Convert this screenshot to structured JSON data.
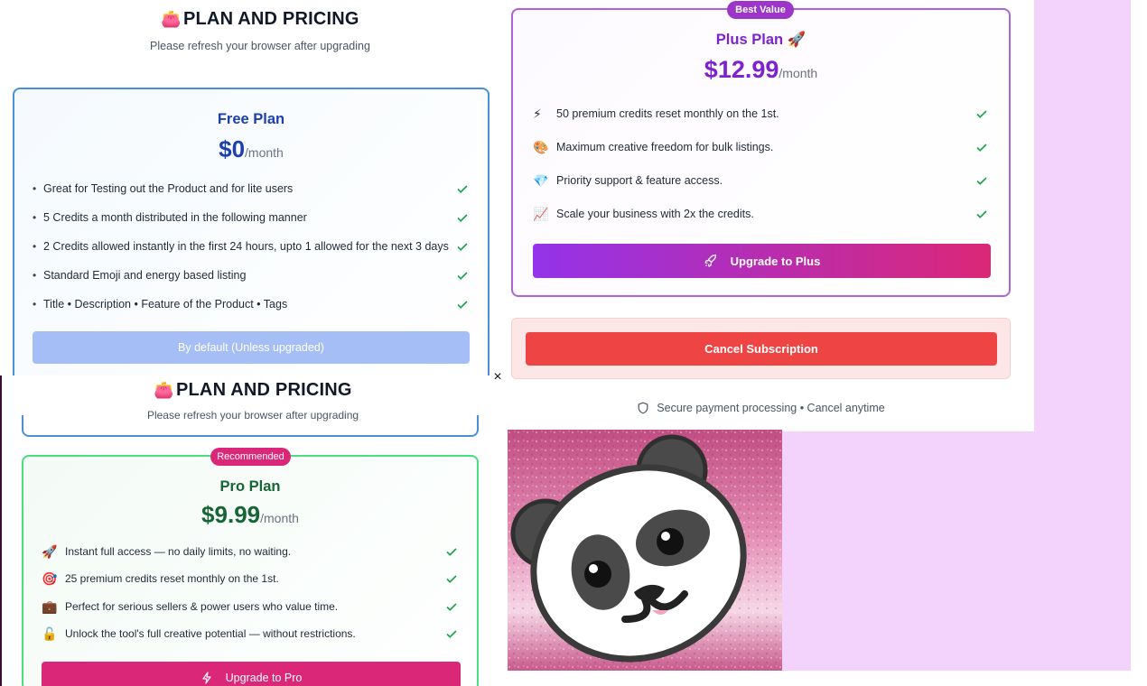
{
  "pricing_top": {
    "title": "PLAN AND PRICING",
    "subtitle": "Please refresh your browser after upgrading"
  },
  "free_plan": {
    "name": "Free Plan",
    "price": "$0",
    "period": "/month",
    "features": [
      "Great for Testing out the Product and for lite users",
      "5 Credits a month distributed in the following manner",
      "2 Credits allowed instantly in the first 24 hours, upto 1 allowed for the next 3 days",
      "Standard Emoji and energy based listing",
      "Title • Description • Feature of the Product • Tags"
    ],
    "button_label": "By default (Unless upgraded)"
  },
  "plus_plan": {
    "badge": "Best Value",
    "name": "Plus Plan 🚀",
    "price": "$12.99",
    "period": "/month",
    "features": [
      {
        "emoji": "⚡",
        "text": "50 premium credits reset monthly on the 1st."
      },
      {
        "emoji": "🎨",
        "text": "Maximum creative freedom for bulk listings."
      },
      {
        "emoji": "💎",
        "text": "Priority support & feature access."
      },
      {
        "emoji": "📈",
        "text": "Scale your business with 2x the credits."
      }
    ],
    "button_label": "Upgrade to Plus"
  },
  "cancel": {
    "button_label": "Cancel Subscription"
  },
  "secure_note": "Secure payment processing • Cancel anytime",
  "modal": {
    "close_glyph": "×",
    "title": "PLAN AND PRICING",
    "subtitle": "Please refresh your browser after upgrading"
  },
  "pro_plan": {
    "badge": "Recommended",
    "name": "Pro Plan",
    "price": "$9.99",
    "period": "/month",
    "features": [
      {
        "emoji": "🚀",
        "text": "Instant full access — no daily limits, no waiting."
      },
      {
        "emoji": "🎯",
        "text": "25 premium credits reset monthly on the 1st."
      },
      {
        "emoji": "💼",
        "text": "Perfect for serious sellers & power users who value time."
      },
      {
        "emoji": "🔓",
        "text": "Unlock the tool's full creative potential — without restrictions."
      }
    ],
    "button_label": "Upgrade to Pro"
  },
  "colors": {
    "free_blue": "#1e40af",
    "plus_purple": "#7e22ce",
    "pro_green": "#166534",
    "cancel_red": "#ef4444",
    "pro_pink": "#db2777",
    "check_green": "#16a34a",
    "lilac_bg": "#f3d2fb"
  },
  "icons": {
    "purse": "purse-icon",
    "check": "check-icon",
    "rocket": "rocket-icon",
    "bolt": "bolt-icon",
    "shield": "shield-icon",
    "close": "close-icon",
    "panda": "panda-sticker"
  }
}
